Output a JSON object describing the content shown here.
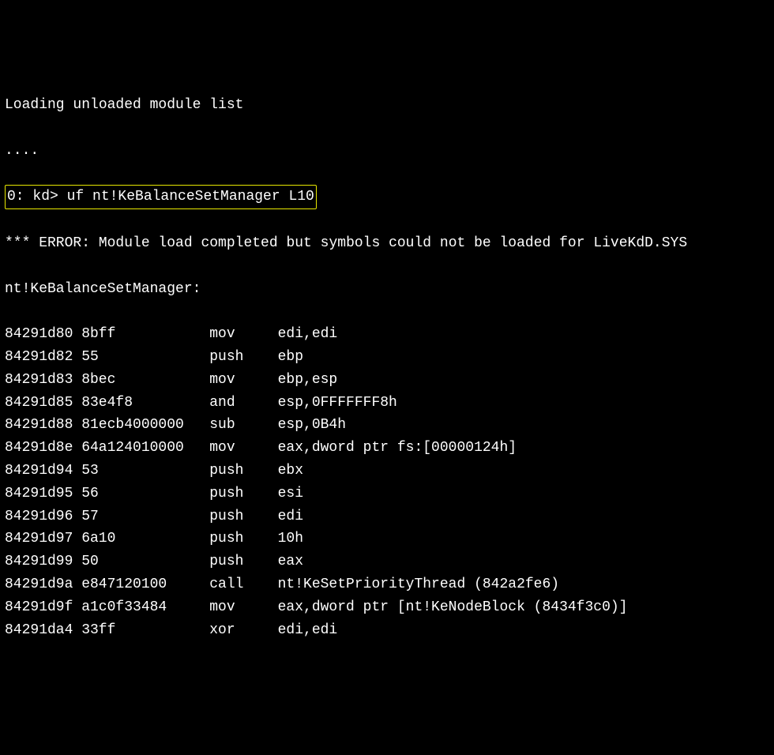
{
  "loading_line": "Loading unloaded module list",
  "dots_line": "....",
  "prompt": "0: kd> uf nt!KeBalanceSetManager L10",
  "error_line": "*** ERROR: Module load completed but symbols could not be loaded for LiveKdD.SYS",
  "symbol_header": "nt!KeBalanceSetManager:",
  "disasm": [
    {
      "addr": "84291d80",
      "bytes": "8bff",
      "mnem": "mov",
      "ops": "edi,edi"
    },
    {
      "addr": "84291d82",
      "bytes": "55",
      "mnem": "push",
      "ops": "ebp"
    },
    {
      "addr": "84291d83",
      "bytes": "8bec",
      "mnem": "mov",
      "ops": "ebp,esp"
    },
    {
      "addr": "84291d85",
      "bytes": "83e4f8",
      "mnem": "and",
      "ops": "esp,0FFFFFFF8h"
    },
    {
      "addr": "84291d88",
      "bytes": "81ecb4000000",
      "mnem": "sub",
      "ops": "esp,0B4h"
    },
    {
      "addr": "84291d8e",
      "bytes": "64a124010000",
      "mnem": "mov",
      "ops": "eax,dword ptr fs:[00000124h]"
    },
    {
      "addr": "84291d94",
      "bytes": "53",
      "mnem": "push",
      "ops": "ebx"
    },
    {
      "addr": "84291d95",
      "bytes": "56",
      "mnem": "push",
      "ops": "esi"
    },
    {
      "addr": "84291d96",
      "bytes": "57",
      "mnem": "push",
      "ops": "edi"
    },
    {
      "addr": "84291d97",
      "bytes": "6a10",
      "mnem": "push",
      "ops": "10h"
    },
    {
      "addr": "84291d99",
      "bytes": "50",
      "mnem": "push",
      "ops": "eax"
    },
    {
      "addr": "84291d9a",
      "bytes": "e847120100",
      "mnem": "call",
      "ops": "nt!KeSetPriorityThread (842a2fe6)"
    },
    {
      "addr": "84291d9f",
      "bytes": "a1c0f33484",
      "mnem": "mov",
      "ops": "eax,dword ptr [nt!KeNodeBlock (8434f3c0)]"
    },
    {
      "addr": "84291da4",
      "bytes": "33ff",
      "mnem": "xor",
      "ops": "edi,edi"
    }
  ]
}
